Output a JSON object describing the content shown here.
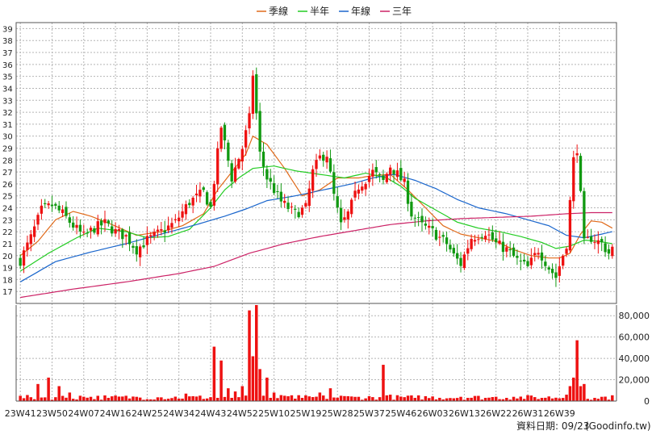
{
  "chart_data": {
    "type": "candlestick",
    "legend": [
      {
        "name": "季線",
        "color": "#e06a1a"
      },
      {
        "name": "半年",
        "color": "#22cc22"
      },
      {
        "name": "年線",
        "color": "#1a66cc"
      },
      {
        "name": "三年",
        "color": "#cc2266"
      }
    ],
    "legend_position": "top-center",
    "grid": true,
    "price_axis": {
      "ticks": [
        17,
        18,
        19,
        20,
        21,
        22,
        23,
        24,
        25,
        26,
        27,
        28,
        29,
        30,
        31,
        32,
        33,
        34,
        35,
        36,
        37,
        38,
        39
      ],
      "ylim": [
        16,
        39.5
      ]
    },
    "volume_axis": {
      "ticks": [
        "0",
        "20,000",
        "40,000",
        "60,000",
        "80,000"
      ],
      "tick_values": [
        0,
        20000,
        40000,
        60000,
        80000
      ],
      "ylim": [
        0,
        90000
      ]
    },
    "x_tick_labels": [
      "23W41",
      "23W50",
      "24W07",
      "24W16",
      "24W25",
      "24W34",
      "24W43",
      "24W52",
      "25W10",
      "25W19",
      "25W28",
      "25W37",
      "25W46",
      "26W03",
      "26W13",
      "26W22",
      "26W31",
      "26W39"
    ],
    "weeks_per_tick": 9,
    "rising_color": "#ee1111",
    "falling_color": "#119911",
    "price_keypoints": [
      [
        0,
        19.6
      ],
      [
        3,
        21.5
      ],
      [
        6,
        23.8
      ],
      [
        9,
        24.2
      ],
      [
        12,
        23.5
      ],
      [
        15,
        22.5
      ],
      [
        18,
        21.6
      ],
      [
        21,
        22.3
      ],
      [
        24,
        22.7
      ],
      [
        27,
        22.0
      ],
      [
        30,
        21.6
      ],
      [
        33,
        20.5
      ],
      [
        36,
        21.3
      ],
      [
        40,
        22.0
      ],
      [
        44,
        22.8
      ],
      [
        48,
        24.5
      ],
      [
        52,
        25.3
      ],
      [
        54,
        24.0
      ],
      [
        57,
        30.8
      ],
      [
        60,
        26.5
      ],
      [
        63,
        29.0
      ],
      [
        65,
        31.5
      ],
      [
        66,
        35.2
      ],
      [
        68,
        28.5
      ],
      [
        70,
        26.5
      ],
      [
        74,
        24.5
      ],
      [
        78,
        23.5
      ],
      [
        81,
        24.0
      ],
      [
        83,
        27.0
      ],
      [
        85,
        28.2
      ],
      [
        87,
        28.5
      ],
      [
        89,
        25.0
      ],
      [
        91,
        22.5
      ],
      [
        93,
        23.5
      ],
      [
        96,
        25.8
      ],
      [
        100,
        27.0
      ],
      [
        103,
        26.2
      ],
      [
        105,
        27.5
      ],
      [
        107,
        26.8
      ],
      [
        109,
        26.0
      ],
      [
        111,
        23.5
      ],
      [
        114,
        22.5
      ],
      [
        117,
        22.0
      ],
      [
        121,
        21.0
      ],
      [
        123,
        20.0
      ],
      [
        125,
        19.3
      ],
      [
        128,
        21.5
      ],
      [
        132,
        22.0
      ],
      [
        135,
        21.0
      ],
      [
        138,
        20.5
      ],
      [
        141,
        19.6
      ],
      [
        144,
        19.0
      ],
      [
        147,
        20.5
      ],
      [
        150,
        19.0
      ],
      [
        152,
        18.2
      ],
      [
        155,
        21.0
      ],
      [
        156,
        24.5
      ],
      [
        157,
        28.0
      ],
      [
        158,
        29.0
      ],
      [
        160,
        21.0
      ],
      [
        162,
        21.5
      ],
      [
        165,
        21.0
      ],
      [
        167,
        20.2
      ],
      [
        168,
        20.6
      ]
    ],
    "ma_keypoints": {
      "季線": [
        [
          0,
          20.0
        ],
        [
          5,
          21.2
        ],
        [
          10,
          23.0
        ],
        [
          15,
          23.7
        ],
        [
          20,
          23.3
        ],
        [
          26,
          22.6
        ],
        [
          33,
          21.7
        ],
        [
          40,
          22.0
        ],
        [
          46,
          22.5
        ],
        [
          52,
          23.5
        ],
        [
          56,
          25.5
        ],
        [
          60,
          27.0
        ],
        [
          64,
          28.5
        ],
        [
          66,
          30.0
        ],
        [
          70,
          29.3
        ],
        [
          75,
          27.3
        ],
        [
          80,
          25.0
        ],
        [
          85,
          25.5
        ],
        [
          90,
          26.5
        ],
        [
          96,
          26.5
        ],
        [
          100,
          26.7
        ],
        [
          105,
          26.8
        ],
        [
          110,
          25.5
        ],
        [
          115,
          24.0
        ],
        [
          120,
          22.5
        ],
        [
          125,
          21.8
        ],
        [
          130,
          21.5
        ],
        [
          135,
          21.2
        ],
        [
          140,
          20.5
        ],
        [
          145,
          20.0
        ],
        [
          150,
          19.8
        ],
        [
          153,
          19.8
        ],
        [
          156,
          20.2
        ],
        [
          159,
          21.8
        ],
        [
          162,
          22.9
        ],
        [
          165,
          22.8
        ],
        [
          168,
          22.3
        ]
      ],
      "半年": [
        [
          0,
          18.7
        ],
        [
          8,
          20.2
        ],
        [
          16,
          21.5
        ],
        [
          22,
          22.3
        ],
        [
          30,
          22.0
        ],
        [
          36,
          21.5
        ],
        [
          42,
          21.6
        ],
        [
          48,
          22.2
        ],
        [
          54,
          24.0
        ],
        [
          58,
          25.5
        ],
        [
          62,
          26.5
        ],
        [
          66,
          27.3
        ],
        [
          72,
          27.5
        ],
        [
          78,
          27.1
        ],
        [
          85,
          26.8
        ],
        [
          92,
          26.5
        ],
        [
          98,
          26.9
        ],
        [
          104,
          26.5
        ],
        [
          108,
          25.8
        ],
        [
          112,
          24.8
        ],
        [
          118,
          23.8
        ],
        [
          124,
          22.8
        ],
        [
          130,
          22.3
        ],
        [
          136,
          22.0
        ],
        [
          142,
          21.6
        ],
        [
          148,
          21.1
        ],
        [
          152,
          20.6
        ],
        [
          156,
          20.8
        ],
        [
          160,
          21.3
        ],
        [
          164,
          21.2
        ],
        [
          168,
          21.0
        ]
      ],
      "年線": [
        [
          0,
          17.8
        ],
        [
          10,
          19.5
        ],
        [
          20,
          20.3
        ],
        [
          30,
          21.0
        ],
        [
          40,
          21.8
        ],
        [
          50,
          22.6
        ],
        [
          58,
          23.3
        ],
        [
          64,
          23.9
        ],
        [
          70,
          24.6
        ],
        [
          78,
          25.0
        ],
        [
          86,
          25.5
        ],
        [
          94,
          26.0
        ],
        [
          100,
          26.5
        ],
        [
          106,
          26.8
        ],
        [
          112,
          26.3
        ],
        [
          118,
          25.6
        ],
        [
          124,
          24.7
        ],
        [
          130,
          24.0
        ],
        [
          138,
          23.5
        ],
        [
          144,
          23.0
        ],
        [
          150,
          22.5
        ],
        [
          155,
          21.7
        ],
        [
          160,
          21.5
        ],
        [
          165,
          21.8
        ],
        [
          168,
          22.0
        ]
      ],
      "三年": [
        [
          0,
          16.5
        ],
        [
          15,
          17.2
        ],
        [
          30,
          17.8
        ],
        [
          45,
          18.5
        ],
        [
          55,
          19.1
        ],
        [
          65,
          20.2
        ],
        [
          75,
          21.0
        ],
        [
          85,
          21.6
        ],
        [
          95,
          22.1
        ],
        [
          105,
          22.6
        ],
        [
          115,
          22.9
        ],
        [
          125,
          23.1
        ],
        [
          135,
          23.2
        ],
        [
          145,
          23.3
        ],
        [
          155,
          23.5
        ],
        [
          162,
          23.6
        ],
        [
          168,
          23.6
        ]
      ]
    },
    "volume_spikes": [
      [
        5,
        16000
      ],
      [
        8,
        22000
      ],
      [
        11,
        14000
      ],
      [
        14,
        8000
      ],
      [
        17,
        5000
      ],
      [
        20,
        4000
      ],
      [
        25,
        3000
      ],
      [
        33,
        4000
      ],
      [
        40,
        3500
      ],
      [
        47,
        7000
      ],
      [
        55,
        51000
      ],
      [
        57,
        38000
      ],
      [
        59,
        12000
      ],
      [
        61,
        9000
      ],
      [
        63,
        14000
      ],
      [
        65,
        85000
      ],
      [
        66,
        42000
      ],
      [
        67,
        90000
      ],
      [
        68,
        30000
      ],
      [
        70,
        22000
      ],
      [
        72,
        8000
      ],
      [
        75,
        5000
      ],
      [
        80,
        3000
      ],
      [
        85,
        8000
      ],
      [
        88,
        12000
      ],
      [
        91,
        5000
      ],
      [
        96,
        4000
      ],
      [
        103,
        34000
      ],
      [
        105,
        6000
      ],
      [
        112,
        3000
      ],
      [
        125,
        4000
      ],
      [
        132,
        3000
      ],
      [
        140,
        4000
      ],
      [
        148,
        3000
      ],
      [
        155,
        6000
      ],
      [
        156,
        14000
      ],
      [
        157,
        22000
      ],
      [
        158,
        57000
      ],
      [
        159,
        14000
      ],
      [
        160,
        16000
      ],
      [
        163,
        3000
      ]
    ]
  },
  "footer": {
    "date_label": "資料日期: 09/23",
    "brand": "(Goodinfo.tw)"
  }
}
